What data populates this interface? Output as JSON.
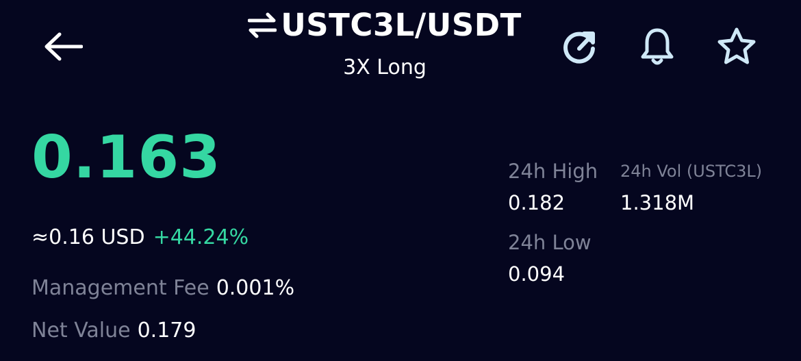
{
  "header": {
    "pair": "USTC3L/USDT",
    "subtitle": "3X Long",
    "icons": {
      "back": "back-arrow-icon",
      "swap": "swap-icon",
      "refresh": "refresh-icon",
      "alert": "bell-icon",
      "favorite": "star-icon"
    }
  },
  "ticker": {
    "last_price": "0.163",
    "usd_equiv": "≈0.16 USD",
    "change_pct": "+44.24%",
    "management_fee_label": "Management Fee",
    "management_fee_value": "0.001%",
    "net_value_label": "Net Value",
    "net_value_value": "0.179"
  },
  "stats": {
    "high_label": "24h High",
    "high_value": "0.182",
    "vol_label": "24h Vol (USTC3L)",
    "vol_value": "1.318M",
    "low_label": "24h Low",
    "low_value": "0.094"
  },
  "colors": {
    "background": "#05061f",
    "accent_green": "#35d7a2",
    "muted_text": "#7f8397",
    "icon_light_blue": "#cfe8f7"
  }
}
